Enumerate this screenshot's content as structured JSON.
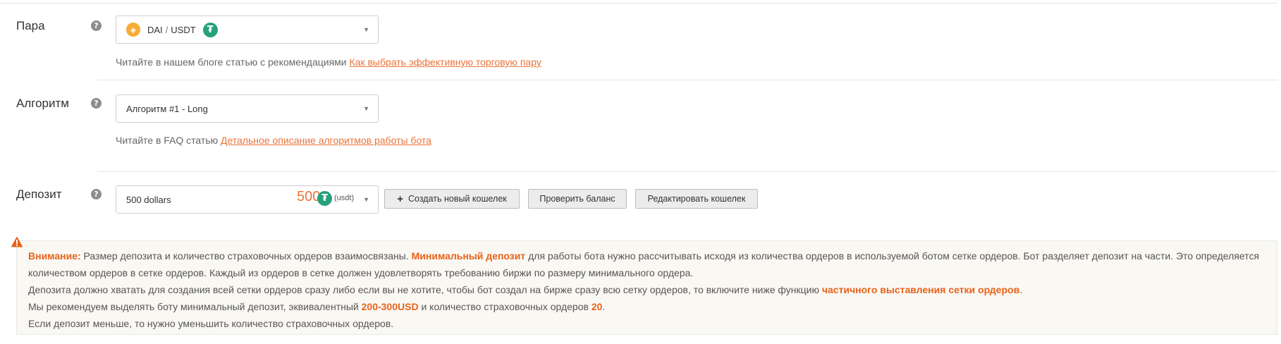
{
  "pair": {
    "label": "Пара",
    "help": "?",
    "selected_base": "DAI",
    "selected_sep": "/",
    "selected_quote": "USDT",
    "base_icon": "dai-coin-icon",
    "quote_icon": "tether-icon",
    "hint_text": "Читайте в нашем блоге статью с рекомендациями ",
    "hint_link": "Как выбрать эффективную торговую пару"
  },
  "algorithm": {
    "label": "Алгоритм",
    "help": "?",
    "selected": "Алгоритм #1 - Long",
    "hint_text": "Читайте в FAQ статью ",
    "hint_link": "Детальное описание алгоритмов работы бота"
  },
  "deposit": {
    "label": "Депозит",
    "help": "?",
    "selected": "500 dollars",
    "amount": "500",
    "unit": "(usdt)",
    "buttons": {
      "create_wallet": "Создать новый кошелек",
      "create_wallet_plus": "+",
      "check_balance": "Проверить баланс",
      "edit_wallet": "Редактировать кошелек"
    }
  },
  "warning": {
    "icon": "warning-triangle-icon",
    "title": "Внимание:",
    "p1_text1": " Размер депозита и количество страховочных ордеров взаимосвязаны. ",
    "p1_bold": "Минимальный депозит",
    "p1_text2": " для работы бота нужно рассчитывать исходя из количества ордеров в используемой ботом сетке ордеров. Бот разделяет депозит на части. Это определяется количеством ордеров в сетке ордеров. Каждый из ордеров в сетке должен удовлетворять требованию биржи по размеру минимального ордера.",
    "p2_text": "Депозита должно хватать для создания всей сетки ордеров сразу либо если вы не хотите, чтобы бот создал на бирже сразу всю сетку ордеров, то включите ниже функцию ",
    "p2_bold": "частичного выставления сетки ордеров",
    "p2_end": ".",
    "p3_text1": "Мы рекомендуем выделять боту минимальный депозит, эквивалентный ",
    "p3_bold1": "200-300USD",
    "p3_text2": " и количество страховочных ордеров ",
    "p3_bold2": "20",
    "p3_end": ".",
    "p4_text": "Если депозит меньше, то нужно уменьшить количество страховочных ордеров."
  },
  "colors": {
    "accent": "#e8743b",
    "warning": "#e8621a",
    "dai": "#f5ac37",
    "tether": "#26a17b"
  }
}
